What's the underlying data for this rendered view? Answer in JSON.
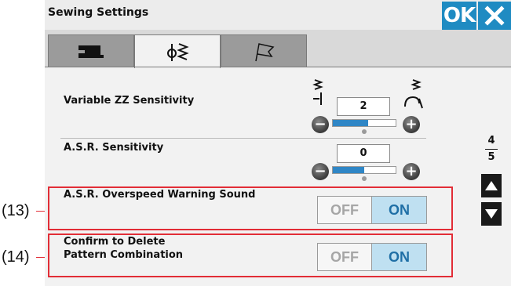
{
  "window": {
    "title": "Sewing Settings"
  },
  "buttons": {
    "ok": "OK",
    "close_icon": "close-icon"
  },
  "tabs": [
    {
      "name": "machine-tab",
      "icon": "sewing-machine-icon",
      "active": false
    },
    {
      "name": "stitch-tab",
      "icon": "stitch-icon",
      "active": true
    },
    {
      "name": "flag-tab",
      "icon": "flag-icon",
      "active": false
    }
  ],
  "settings": {
    "zz_sensitivity": {
      "label": "Variable ZZ Sensitivity",
      "value": "2",
      "level": 0.55
    },
    "asr_sensitivity": {
      "label": "A.S.R. Sensitivity",
      "value": "0",
      "level": 0.5
    },
    "asr_warning": {
      "label": "A.S.R. Overspeed Warning Sound",
      "off": "OFF",
      "on": "ON",
      "selected": "ON"
    },
    "confirm_delete": {
      "label_line1": "Confirm to Delete",
      "label_line2": "Pattern Combination",
      "off": "OFF",
      "on": "ON",
      "selected": "ON"
    }
  },
  "pager": {
    "current": "4",
    "total": "5"
  },
  "callouts": {
    "c13": "(13)",
    "c14": "(14)"
  },
  "colors": {
    "accent": "#1f8bc2",
    "highlight": "#e22d36",
    "on_bg": "#bfe0f1"
  }
}
